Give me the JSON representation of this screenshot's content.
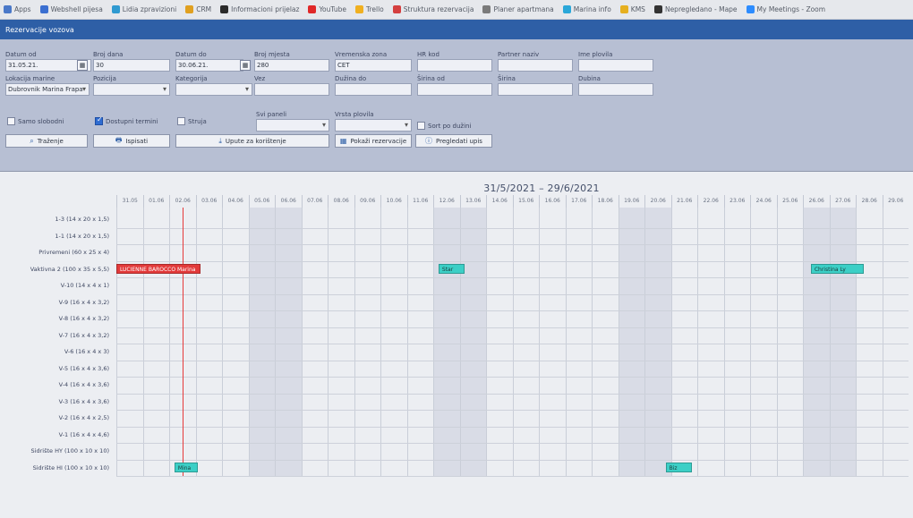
{
  "bookmarks": [
    {
      "label": "Apps",
      "color": "#4a78c8"
    },
    {
      "label": "Webshell pijesa",
      "color": "#3b6fd1"
    },
    {
      "label": "Lidia zpravizioni",
      "color": "#2f9ad1"
    },
    {
      "label": "CRM",
      "color": "#e0a020"
    },
    {
      "label": "Informacioni prijelaz",
      "color": "#2b2b2b"
    },
    {
      "label": "YouTube",
      "color": "#e02828"
    },
    {
      "label": "Trello",
      "color": "#f0b020"
    },
    {
      "label": "Struktura rezervacija",
      "color": "#d43f3f"
    },
    {
      "label": "Planer apartmana",
      "color": "#7a7a7a"
    },
    {
      "label": "Marina info",
      "color": "#2aa7d9"
    },
    {
      "label": "KMS",
      "color": "#e6b020"
    },
    {
      "label": "Nepregledano - Mape",
      "color": "#333333"
    },
    {
      "label": "My Meetings - Zoom",
      "color": "#2d8cff"
    }
  ],
  "app": {
    "title": "Rezervacije vozova"
  },
  "filters": {
    "datum_od": {
      "label": "Datum od",
      "value": "31.05.21."
    },
    "broj_dana": {
      "label": "Broj dana",
      "value": "30"
    },
    "datum_do": {
      "label": "Datum do",
      "value": "30.06.21."
    },
    "broj_mjesta": {
      "label": "Broj mjesta",
      "value": "280"
    },
    "vremenska_zona": {
      "label": "Vremenska zona",
      "value": "CET"
    },
    "hr_kod": {
      "label": "HR kod",
      "value": ""
    },
    "partner_naziv": {
      "label": "Partner naziv",
      "value": ""
    },
    "ime_plovila": {
      "label": "Ime plovila",
      "value": ""
    },
    "lokacija_marine": {
      "label": "Lokacija marine",
      "value": "Dubrovnik Marina Frapa"
    },
    "pozicija": {
      "label": "Pozicija",
      "value": ""
    },
    "kategorija": {
      "label": "Kategorija",
      "value": ""
    },
    "vez": {
      "label": "Vez",
      "value": ""
    },
    "duzina_do": {
      "label": "Dužina do",
      "value": ""
    },
    "sirina_od": {
      "label": "Širina od",
      "value": ""
    },
    "sirina": {
      "label": "Širina",
      "value": ""
    },
    "dubina": {
      "label": "Dubina",
      "value": ""
    },
    "svi_paneli": {
      "label": "Svi paneli",
      "value": ""
    },
    "vrsta_plovila": {
      "label": "Vrsta plovila",
      "value": ""
    },
    "samo_slobodni": {
      "label": "Samo slobodni",
      "checked": false
    },
    "dostupni_termini": {
      "label": "Dostupni termini",
      "checked": true
    },
    "struja": {
      "label": "Struja",
      "checked": false
    },
    "sort_po_duzini": {
      "label": "Sort po dužini",
      "checked": false
    }
  },
  "buttons": {
    "trazenje": "Traženje",
    "ispisati": "Ispisati",
    "upute": "Upute za korištenje",
    "pokazi_rezervacije": "Pokaži rezervacije",
    "pregledati_upis": "Pregledati upis"
  },
  "schedule": {
    "range": "31/5/2021 – 29/6/2021",
    "dates": [
      "31.05",
      "01.06",
      "02.06",
      "03.06",
      "04.06",
      "05.06",
      "06.06",
      "07.06",
      "08.06",
      "09.06",
      "10.06",
      "11.06",
      "12.06",
      "13.06",
      "14.06",
      "15.06",
      "16.06",
      "17.06",
      "18.06",
      "19.06",
      "20.06",
      "21.06",
      "22.06",
      "23.06",
      "24.06",
      "25.06",
      "26.06",
      "27.06",
      "28.06",
      "29.06"
    ],
    "weekend_indices": [
      5,
      6,
      12,
      13,
      19,
      20,
      26,
      27
    ],
    "today_index": 2,
    "rows": [
      "1-3 (14 x 20 x 1,5)",
      "1-1 (14 x 20 x 1,5)",
      "Privremeni (60 x 25 x 4)",
      "Vaktivna 2 (100 x 35 x 5,5)",
      "V-10 (14 x 4 x 1)",
      "V-9 (16 x 4 x 3,2)",
      "V-8 (16 x 4 x 3,2)",
      "V-7 (16 x 4 x 3,2)",
      "V-6 (16 x 4 x 3)",
      "V-5 (16 x 4 x 3,6)",
      "V-4 (16 x 4 x 3,6)",
      "V-3 (16 x 4 x 3,6)",
      "V-2 (16 x 4 x 2,5)",
      "V-1 (16 x 4 x 4,6)",
      "Sidrište HY (100 x 10 x 10)",
      "Sidrište HI (100 x 10 x 10)"
    ],
    "bookings": [
      {
        "row": 3,
        "start": 0,
        "span": 3.2,
        "label": "LUCIENNE BAROCCO Marina",
        "color": "#e23a3a",
        "text_color": "#ffffff"
      },
      {
        "row": 3,
        "start": 12.2,
        "span": 1,
        "label": "Star",
        "color": "#3ccfc6",
        "text_color": "#1a3b3b"
      },
      {
        "row": 3,
        "start": 26.3,
        "span": 2,
        "label": "Christina Ly",
        "color": "#3ccfc6",
        "text_color": "#1a3b3b"
      },
      {
        "row": 15,
        "start": 2.2,
        "span": 0.9,
        "label": "Mina",
        "color": "#3ccfc6",
        "text_color": "#1a3b3b"
      },
      {
        "row": 15,
        "start": 20.8,
        "span": 1,
        "label": "Biz",
        "color": "#3ccfc6",
        "text_color": "#1a3b3b"
      }
    ]
  }
}
